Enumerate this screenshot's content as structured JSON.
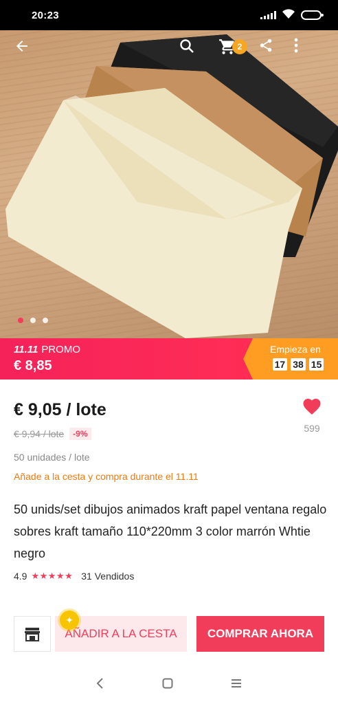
{
  "status_bar": {
    "time": "20:23",
    "icons": [
      "signal-icon",
      "wifi-icon",
      "battery-icon"
    ]
  },
  "hero": {
    "nav_icons": [
      "back-arrow-icon",
      "search-icon",
      "cart-icon",
      "share-icon",
      "more-icon"
    ],
    "cart_count": "2",
    "carousel_total": 3,
    "carousel_active": 1
  },
  "promo": {
    "event": "11.11",
    "label": "PROMO",
    "price": "€ 8,85",
    "countdown_label": "Empieza en",
    "countdown": {
      "h": "17",
      "m": "38",
      "s": "15"
    }
  },
  "product": {
    "price": "€ 9,05 / lote",
    "old_price": "€ 9,94 / lote",
    "discount": "-9%",
    "wishlist_count": "599",
    "units": "50 unidades / lote",
    "promo_note": "Añade a la cesta y compra durante el 11.11",
    "title": "50 unids/set dibujos animados kraft papel ventana regalo sobres kraft tamaño 110*220mm 3 color marrón Whtie negro",
    "rating": "4.9",
    "stars": "★★★★★",
    "sold": "31 Vendidos"
  },
  "actions": {
    "add_to_cart": "AÑADIR A LA CESTA",
    "buy_now": "COMPRAR AHORA"
  },
  "colors": {
    "accent": "#f23d5a",
    "promo_orange": "#ff9c22",
    "note_orange": "#f07a10"
  }
}
